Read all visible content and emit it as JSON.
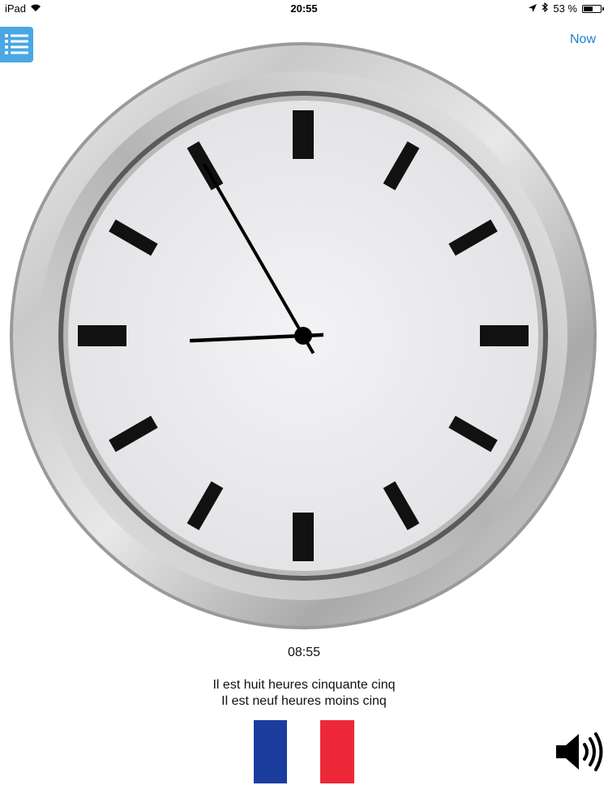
{
  "status_bar": {
    "device": "iPad",
    "time": "20:55",
    "battery": "53 %",
    "battery_level": 0.53
  },
  "toolbar": {
    "menu_icon": "list-icon",
    "now_label": "Now"
  },
  "clock": {
    "hour": 8,
    "minute": 55,
    "digital": "08:55"
  },
  "phrases": {
    "line1": "Il est huit heures cinquante cinq",
    "line2": "Il est neuf heures moins cinq"
  },
  "language": {
    "flag_icon": "france-flag-icon",
    "colors": [
      "#1b3d9e",
      "#ffffff",
      "#ed2939"
    ]
  },
  "audio": {
    "icon": "speaker-icon"
  }
}
